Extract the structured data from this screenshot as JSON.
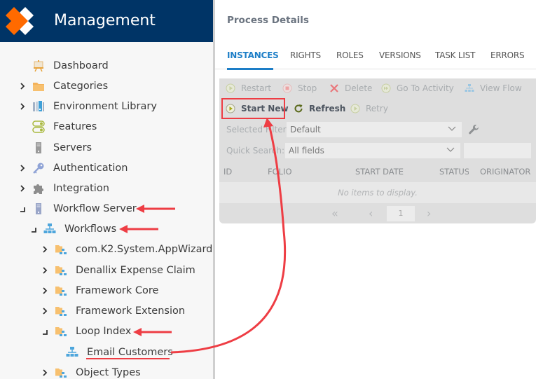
{
  "brand": {
    "title": "Management",
    "logo_icon": "k2-x-logo",
    "colors": {
      "header_bg": "#003466",
      "logo_orange": "#ff6a00"
    }
  },
  "sidebar": {
    "items": [
      {
        "label": "Dashboard",
        "icon": "dashboard-easel-icon",
        "toggle": "none",
        "level": 0
      },
      {
        "label": "Categories",
        "icon": "folder-icon",
        "toggle": "expand",
        "level": 0
      },
      {
        "label": "Environment Library",
        "icon": "library-icon",
        "toggle": "expand",
        "level": 0
      },
      {
        "label": "Features",
        "icon": "features-toggle-icon",
        "toggle": "none",
        "level": 0
      },
      {
        "label": "Servers",
        "icon": "server-icon",
        "toggle": "none",
        "level": 0
      },
      {
        "label": "Authentication",
        "icon": "key-icon",
        "toggle": "expand",
        "level": 0
      },
      {
        "label": "Integration",
        "icon": "puzzle-icon",
        "toggle": "expand",
        "level": 0
      },
      {
        "label": "Workflow Server",
        "icon": "workflow-server-icon",
        "toggle": "collapse",
        "level": 0
      },
      {
        "label": "Workflows",
        "icon": "workflow-icon",
        "toggle": "collapse",
        "level": 1
      },
      {
        "label": "com.K2.System.AppWizard",
        "icon": "category-workflow-icon",
        "toggle": "expand",
        "level": 2
      },
      {
        "label": "Denallix Expense Claim",
        "icon": "category-workflow-icon",
        "toggle": "expand",
        "level": 2
      },
      {
        "label": "Framework Core",
        "icon": "category-workflow-icon",
        "toggle": "expand",
        "level": 2
      },
      {
        "label": "Framework Extension",
        "icon": "category-workflow-icon",
        "toggle": "expand",
        "level": 2
      },
      {
        "label": "Loop Index",
        "icon": "category-workflow-icon",
        "toggle": "collapse",
        "level": 2
      },
      {
        "label": "Email Customers",
        "icon": "workflow-icon",
        "toggle": "none",
        "level": 3
      },
      {
        "label": "Object Types",
        "icon": "category-workflow-icon",
        "toggle": "expand",
        "level": 2
      }
    ]
  },
  "main": {
    "title": "Process Details",
    "tabs": [
      {
        "label": "INSTANCES",
        "active": true
      },
      {
        "label": "RIGHTS",
        "active": false
      },
      {
        "label": "ROLES",
        "active": false
      },
      {
        "label": "VERSIONS",
        "active": false
      },
      {
        "label": "TASK LIST",
        "active": false
      },
      {
        "label": "ERRORS",
        "active": false
      }
    ],
    "toolbar": {
      "row1": [
        {
          "label": "Restart",
          "icon": "play-circle-icon",
          "enabled": false
        },
        {
          "label": "Stop",
          "icon": "stop-circle-icon",
          "enabled": false
        },
        {
          "label": "Delete",
          "icon": "delete-x-icon",
          "enabled": false
        },
        {
          "label": "Go To Activity",
          "icon": "fast-forward-circle-icon",
          "enabled": false
        },
        {
          "label": "View Flow",
          "icon": "flow-chart-icon",
          "enabled": false
        }
      ],
      "row2": [
        {
          "label": "Start New",
          "icon": "play-circle-icon",
          "enabled": true
        },
        {
          "label": "Refresh",
          "icon": "refresh-icon",
          "enabled": true
        },
        {
          "label": "Retry",
          "icon": "play-circle-icon",
          "enabled": false
        }
      ]
    },
    "filter": {
      "selected_filter_label": "Selected Filter:",
      "selected_filter_value": "Default",
      "quick_search_label": "Quick Search:",
      "quick_search_field": "All fields",
      "quick_search_text": ""
    },
    "grid": {
      "columns": [
        "ID",
        "FOLIO",
        "START DATE",
        "STATUS",
        "ORIGINATOR"
      ],
      "empty_message": "No items to display.",
      "pager": {
        "first": "«",
        "prev": "‹",
        "page": "1",
        "next": "›"
      }
    }
  },
  "annotations": {
    "color": "#ee3d44",
    "highlighted_button": "Start New",
    "arrows_to": [
      "Workflow Server",
      "Workflows",
      "Loop Index"
    ],
    "underlined_item": "Email Customers"
  }
}
